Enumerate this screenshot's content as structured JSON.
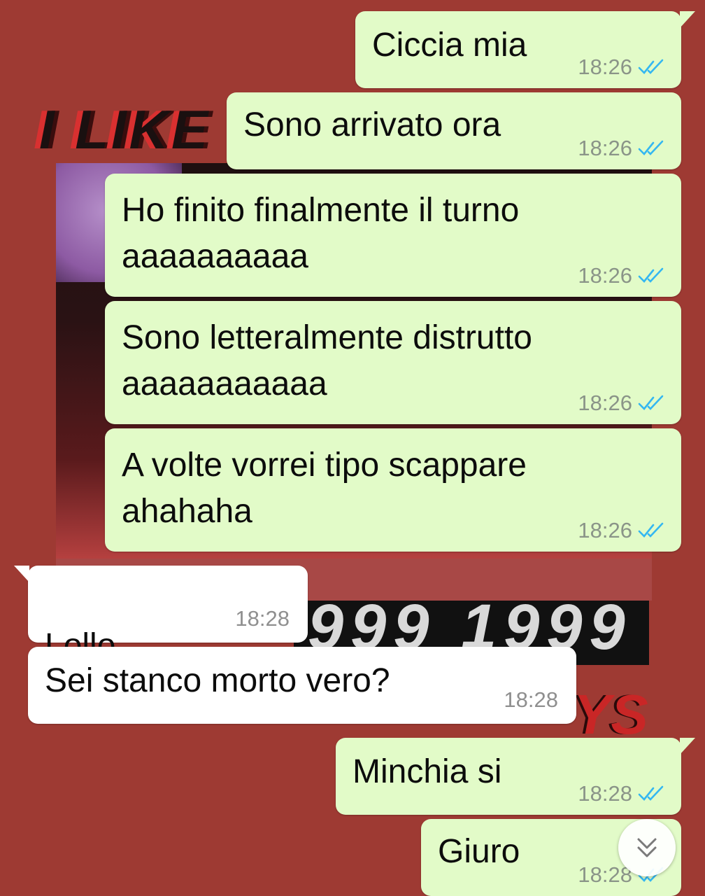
{
  "wallpaper": {
    "title_text": "I LIKE",
    "year_text": "999 1999",
    "bottom_text": "YS"
  },
  "messages": [
    {
      "text": "Ciccia mia",
      "time": "18:26",
      "direction": "out",
      "status": "read"
    },
    {
      "text": "Sono arrivato ora",
      "time": "18:26",
      "direction": "out",
      "status": "read"
    },
    {
      "text": "Ho finito finalmente il turno\naaaaaaaaaa",
      "time": "18:26",
      "direction": "out",
      "status": "read"
    },
    {
      "text": "Sono letteralmente distrutto\naaaaaaaaaaa",
      "time": "18:26",
      "direction": "out",
      "status": "read"
    },
    {
      "text": "A volte vorrei tipo scappare\nahahaha",
      "time": "18:26",
      "direction": "out",
      "status": "read"
    },
    {
      "text": "Lollo",
      "emoji": "❤️",
      "time": "18:28",
      "direction": "in"
    },
    {
      "text": "Sei stanco morto vero?",
      "time": "18:28",
      "direction": "in"
    },
    {
      "text": "Minchia si",
      "time": "18:28",
      "direction": "out",
      "status": "read"
    },
    {
      "text": "Giuro",
      "time": "18:28",
      "direction": "out",
      "status": "read"
    }
  ],
  "icons": {
    "read_receipt": "double-check-icon",
    "scroll_down": "chevron-double-down-icon"
  },
  "colors": {
    "background": "#9e3a33",
    "outgoing_bubble": "#e2fbc8",
    "incoming_bubble": "#ffffff",
    "read_tick": "#34b7f1"
  }
}
